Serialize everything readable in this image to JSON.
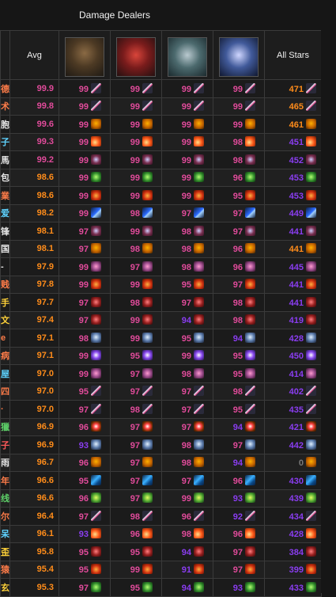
{
  "title": "Damage Dealers",
  "headers": {
    "avg": "Avg",
    "all": "All Stars"
  },
  "portraits": [
    {
      "name": "portrait-hero-1",
      "cls": "p-a"
    },
    {
      "name": "portrait-hero-2",
      "cls": "p-b"
    },
    {
      "name": "portrait-hero-3",
      "cls": "p-c"
    },
    {
      "name": "portrait-hero-4",
      "cls": "p-d"
    }
  ],
  "colors": {
    "pink": "#e14b9b",
    "orange": "#ff8c1a",
    "purple": "#8a3df0",
    "grey": "#7a7a7a",
    "border": "#3a3a3a"
  },
  "rows": [
    {
      "n": "德",
      "nc": "#ff7d4a",
      "avg": "99.9",
      "ac": "pink",
      "s": [
        "99",
        "99",
        "99",
        "99"
      ],
      "sc": [
        "pink",
        "pink",
        "pink",
        "pink"
      ],
      "all": "471",
      "alc": "orange",
      "icon": "slash"
    },
    {
      "n": "术",
      "nc": "#ff7d4a",
      "avg": "99.8",
      "ac": "pink",
      "s": [
        "99",
        "99",
        "99",
        "99"
      ],
      "sc": [
        "pink",
        "pink",
        "pink",
        "pink"
      ],
      "all": "465",
      "alc": "orange",
      "icon": "slash"
    },
    {
      "n": "胞",
      "nc": "#e6e6e6",
      "avg": "99.6",
      "ac": "pink",
      "s": [
        "99",
        "99",
        "99",
        "99"
      ],
      "sc": [
        "pink",
        "pink",
        "pink",
        "pink"
      ],
      "all": "461",
      "alc": "orange",
      "icon": "mask"
    },
    {
      "n": "子",
      "nc": "#5fd3ff",
      "avg": "99.3",
      "ac": "pink",
      "s": [
        "99",
        "99",
        "99",
        "98"
      ],
      "sc": [
        "pink",
        "pink",
        "pink",
        "pink"
      ],
      "all": "451",
      "alc": "purple",
      "icon": "flame"
    },
    {
      "n": "馬",
      "nc": "#e6e6e6",
      "avg": "99.2",
      "ac": "pink",
      "s": [
        "99",
        "99",
        "99",
        "98"
      ],
      "sc": [
        "pink",
        "pink",
        "pink",
        "pink"
      ],
      "all": "452",
      "alc": "purple",
      "icon": "demon"
    },
    {
      "n": "包",
      "nc": "#e6e6e6",
      "avg": "98.6",
      "ac": "orange",
      "s": [
        "99",
        "99",
        "99",
        "96"
      ],
      "sc": [
        "pink",
        "pink",
        "pink",
        "pink"
      ],
      "all": "453",
      "alc": "purple",
      "icon": "leaf"
    },
    {
      "n": "業",
      "nc": "#ff7d4a",
      "avg": "98.6",
      "ac": "orange",
      "s": [
        "99",
        "99",
        "99",
        "95"
      ],
      "sc": [
        "pink",
        "pink",
        "pink",
        "pink"
      ],
      "all": "453",
      "alc": "purple",
      "icon": "fire"
    },
    {
      "n": "爱",
      "nc": "#5fd3ff",
      "avg": "98.2",
      "ac": "orange",
      "s": [
        "99",
        "98",
        "97",
        "97"
      ],
      "sc": [
        "pink",
        "pink",
        "pink",
        "pink"
      ],
      "all": "449",
      "alc": "purple",
      "icon": "bolt"
    },
    {
      "n": "锋",
      "nc": "#e6e6e6",
      "avg": "98.1",
      "ac": "orange",
      "s": [
        "97",
        "99",
        "98",
        "97"
      ],
      "sc": [
        "pink",
        "pink",
        "pink",
        "pink"
      ],
      "all": "441",
      "alc": "purple",
      "icon": "demon"
    },
    {
      "n": "国",
      "nc": "#e6e6e6",
      "avg": "98.1",
      "ac": "orange",
      "s": [
        "97",
        "98",
        "98",
        "96"
      ],
      "sc": [
        "pink",
        "pink",
        "pink",
        "pink"
      ],
      "all": "441",
      "alc": "orange",
      "icon": "mask"
    },
    {
      "n": "-",
      "nc": "#e6e6e6",
      "avg": "97.9",
      "ac": "orange",
      "s": [
        "99",
        "97",
        "98",
        "96"
      ],
      "sc": [
        "pink",
        "pink",
        "pink",
        "pink"
      ],
      "all": "445",
      "alc": "purple",
      "icon": "goblin"
    },
    {
      "n": "贱",
      "nc": "#ff7d4a",
      "avg": "97.8",
      "ac": "orange",
      "s": [
        "99",
        "99",
        "95",
        "97"
      ],
      "sc": [
        "pink",
        "pink",
        "pink",
        "pink"
      ],
      "all": "441",
      "alc": "purple",
      "icon": "fire"
    },
    {
      "n": "手",
      "nc": "#ffd23a",
      "avg": "97.7",
      "ac": "orange",
      "s": [
        "97",
        "98",
        "97",
        "98"
      ],
      "sc": [
        "pink",
        "pink",
        "pink",
        "pink"
      ],
      "all": "441",
      "alc": "purple",
      "icon": "axe"
    },
    {
      "n": "文",
      "nc": "#ffd23a",
      "avg": "97.4",
      "ac": "orange",
      "s": [
        "97",
        "99",
        "94",
        "98"
      ],
      "sc": [
        "pink",
        "pink",
        "purple",
        "pink"
      ],
      "all": "419",
      "alc": "purple",
      "icon": "axe"
    },
    {
      "n": "e",
      "nc": "#ff7d4a",
      "avg": "97.1",
      "ac": "orange",
      "s": [
        "98",
        "99",
        "95",
        "94"
      ],
      "sc": [
        "pink",
        "pink",
        "pink",
        "purple"
      ],
      "all": "428",
      "alc": "purple",
      "icon": "skull"
    },
    {
      "n": "病",
      "nc": "#ff7d4a",
      "avg": "97.1",
      "ac": "orange",
      "s": [
        "99",
        "95",
        "99",
        "95"
      ],
      "sc": [
        "pink",
        "pink",
        "pink",
        "pink"
      ],
      "all": "450",
      "alc": "purple",
      "icon": "eye"
    },
    {
      "n": "屋",
      "nc": "#5fd3ff",
      "avg": "97.0",
      "ac": "orange",
      "s": [
        "99",
        "97",
        "98",
        "95"
      ],
      "sc": [
        "pink",
        "pink",
        "pink",
        "pink"
      ],
      "all": "414",
      "alc": "purple",
      "icon": "goblin"
    },
    {
      "n": "四",
      "nc": "#ff7d4a",
      "avg": "97.0",
      "ac": "orange",
      "s": [
        "95",
        "97",
        "97",
        "98"
      ],
      "sc": [
        "pink",
        "pink",
        "pink",
        "pink"
      ],
      "all": "402",
      "alc": "purple",
      "icon": "slash"
    },
    {
      "n": "·",
      "nc": "#ff7d4a",
      "avg": "97.0",
      "ac": "orange",
      "s": [
        "97",
        "98",
        "97",
        "95"
      ],
      "sc": [
        "pink",
        "pink",
        "pink",
        "pink"
      ],
      "all": "435",
      "alc": "purple",
      "icon": "slash"
    },
    {
      "n": "獵",
      "nc": "#5fd36a",
      "avg": "96.9",
      "ac": "orange",
      "s": [
        "96",
        "97",
        "97",
        "94"
      ],
      "sc": [
        "pink",
        "pink",
        "pink",
        "purple"
      ],
      "all": "421",
      "alc": "purple",
      "icon": "target"
    },
    {
      "n": "子",
      "nc": "#ff5a5a",
      "avg": "96.9",
      "ac": "orange",
      "s": [
        "93",
        "97",
        "98",
        "97"
      ],
      "sc": [
        "purple",
        "pink",
        "pink",
        "pink"
      ],
      "all": "442",
      "alc": "purple",
      "icon": "skull"
    },
    {
      "n": "雨",
      "nc": "#e6e6e6",
      "avg": "96.7",
      "ac": "orange",
      "s": [
        "96",
        "97",
        "98",
        "94"
      ],
      "sc": [
        "pink",
        "pink",
        "pink",
        "purple"
      ],
      "all": "0",
      "alc": "grey",
      "icon": "mask"
    },
    {
      "n": "年",
      "nc": "#ff7d4a",
      "avg": "96.6",
      "ac": "orange",
      "s": [
        "95",
        "97",
        "97",
        "96"
      ],
      "sc": [
        "pink",
        "pink",
        "pink",
        "pink"
      ],
      "all": "430",
      "alc": "purple",
      "icon": "claw"
    },
    {
      "n": "线",
      "nc": "#5fd36a",
      "avg": "96.6",
      "ac": "orange",
      "s": [
        "96",
        "97",
        "99",
        "93"
      ],
      "sc": [
        "pink",
        "pink",
        "pink",
        "purple"
      ],
      "all": "439",
      "alc": "purple",
      "icon": "leaf2"
    },
    {
      "n": "尔",
      "nc": "#ff7d4a",
      "avg": "96.4",
      "ac": "orange",
      "s": [
        "97",
        "98",
        "96",
        "92"
      ],
      "sc": [
        "pink",
        "pink",
        "pink",
        "purple"
      ],
      "all": "434",
      "alc": "purple",
      "icon": "slash"
    },
    {
      "n": "呆",
      "nc": "#5fd3ff",
      "avg": "96.1",
      "ac": "orange",
      "s": [
        "93",
        "96",
        "98",
        "96"
      ],
      "sc": [
        "purple",
        "pink",
        "pink",
        "pink"
      ],
      "all": "428",
      "alc": "purple",
      "icon": "flame"
    },
    {
      "n": "歪",
      "nc": "#ffd23a",
      "avg": "95.8",
      "ac": "orange",
      "s": [
        "95",
        "95",
        "94",
        "97"
      ],
      "sc": [
        "pink",
        "pink",
        "purple",
        "pink"
      ],
      "all": "384",
      "alc": "purple",
      "icon": "axe"
    },
    {
      "n": "猿",
      "nc": "#ff7d4a",
      "avg": "95.4",
      "ac": "orange",
      "s": [
        "95",
        "99",
        "91",
        "97"
      ],
      "sc": [
        "pink",
        "pink",
        "purple",
        "pink"
      ],
      "all": "399",
      "alc": "purple",
      "icon": "fire"
    },
    {
      "n": "玄",
      "nc": "#ffd23a",
      "avg": "95.3",
      "ac": "orange",
      "s": [
        "97",
        "95",
        "94",
        "93"
      ],
      "sc": [
        "pink",
        "pink",
        "purple",
        "purple"
      ],
      "all": "433",
      "alc": "purple",
      "icon": "leaf"
    }
  ]
}
